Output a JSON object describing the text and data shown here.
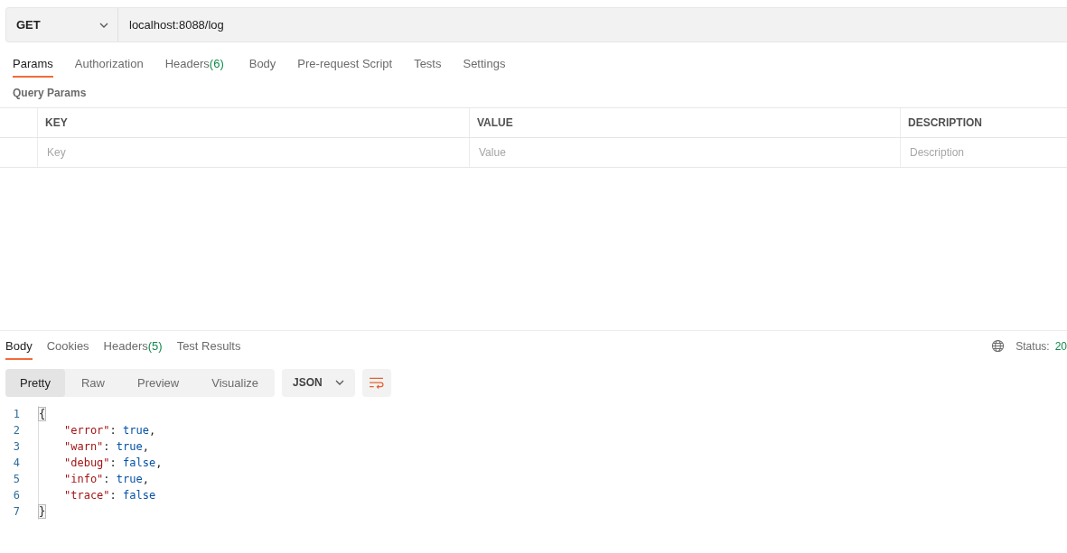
{
  "request": {
    "method": "GET",
    "url": "localhost:8088/log"
  },
  "request_tabs": [
    {
      "label": "Params",
      "selected": true
    },
    {
      "label": "Authorization",
      "selected": false
    },
    {
      "label": "Headers",
      "count": "(6)",
      "selected": false
    },
    {
      "label": "Body",
      "selected": false
    },
    {
      "label": "Pre-request Script",
      "selected": false
    },
    {
      "label": "Tests",
      "selected": false
    },
    {
      "label": "Settings",
      "selected": false
    }
  ],
  "query_params": {
    "title": "Query Params",
    "columns": [
      "KEY",
      "VALUE",
      "DESCRIPTION"
    ],
    "placeholders": [
      "Key",
      "Value",
      "Description"
    ]
  },
  "response_tabs": [
    {
      "label": "Body",
      "selected": true
    },
    {
      "label": "Cookies",
      "selected": false
    },
    {
      "label": "Headers",
      "count": "(5)",
      "selected": false
    },
    {
      "label": "Test Results",
      "selected": false
    }
  ],
  "status": {
    "label": "Status:",
    "value": "20"
  },
  "view_modes": [
    {
      "label": "Pretty",
      "selected": true
    },
    {
      "label": "Raw",
      "selected": false
    },
    {
      "label": "Preview",
      "selected": false
    },
    {
      "label": "Visualize",
      "selected": false
    }
  ],
  "format": "JSON",
  "code_lines": [
    {
      "number": "1",
      "indent": false,
      "tokens": [
        {
          "kind": "bracket",
          "text": "{"
        }
      ]
    },
    {
      "number": "2",
      "indent": true,
      "tokens": [
        {
          "kind": "key",
          "text": "\"error\""
        },
        {
          "kind": "punct",
          "text": ": "
        },
        {
          "kind": "value",
          "text": "true"
        },
        {
          "kind": "punct",
          "text": ","
        }
      ]
    },
    {
      "number": "3",
      "indent": true,
      "tokens": [
        {
          "kind": "key",
          "text": "\"warn\""
        },
        {
          "kind": "punct",
          "text": ": "
        },
        {
          "kind": "value",
          "text": "true"
        },
        {
          "kind": "punct",
          "text": ","
        }
      ]
    },
    {
      "number": "4",
      "indent": true,
      "tokens": [
        {
          "kind": "key",
          "text": "\"debug\""
        },
        {
          "kind": "punct",
          "text": ": "
        },
        {
          "kind": "value",
          "text": "false"
        },
        {
          "kind": "punct",
          "text": ","
        }
      ]
    },
    {
      "number": "5",
      "indent": true,
      "tokens": [
        {
          "kind": "key",
          "text": "\"info\""
        },
        {
          "kind": "punct",
          "text": ": "
        },
        {
          "kind": "value",
          "text": "true"
        },
        {
          "kind": "punct",
          "text": ","
        }
      ]
    },
    {
      "number": "6",
      "indent": true,
      "tokens": [
        {
          "kind": "key",
          "text": "\"trace\""
        },
        {
          "kind": "punct",
          "text": ": "
        },
        {
          "kind": "value",
          "text": "false"
        }
      ]
    },
    {
      "number": "7",
      "indent": false,
      "tokens": [
        {
          "kind": "bracket",
          "text": "}"
        }
      ]
    }
  ]
}
